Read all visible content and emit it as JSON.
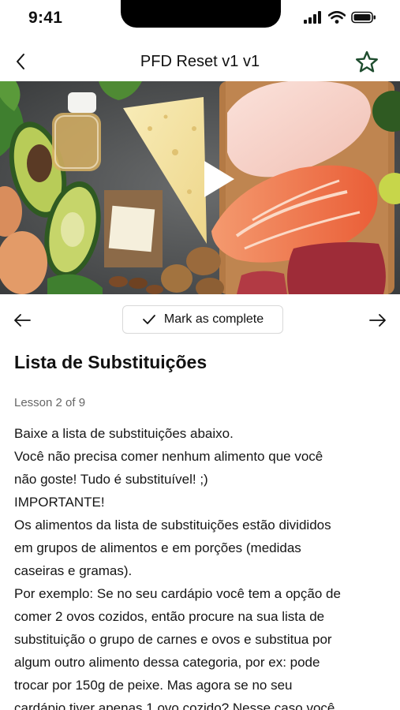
{
  "status_bar": {
    "time": "9:41"
  },
  "header": {
    "title": "PFD Reset v1 v1"
  },
  "hero": {
    "icon": "play-icon",
    "colors": {
      "background": "#4d4f50",
      "salmon": "#f07a4f",
      "cheese": "#f3e3a4"
    }
  },
  "controls": {
    "complete_label": "Mark as complete"
  },
  "lesson": {
    "title": "Lista de Substituições",
    "meta": "Lesson 2 of 9",
    "lines": [
      "Baixe a lista de substituições abaixo.",
      "Você não precisa comer nenhum alimento que você",
      "não goste! Tudo é substituível! ;)",
      "IMPORTANTE!",
      "Os alimentos da lista de substituições estão divididos",
      "em grupos de alimentos e em porções (medidas",
      "caseiras e gramas).",
      "Por exemplo: Se no seu cardápio você tem a opção de",
      "comer 2 ovos cozidos, então procure na sua lista de",
      "substituição o grupo de carnes e ovos e substitua por",
      "algum outro alimento dessa categoria, por ex: pode",
      "trocar por 150g de peixe. Mas agora se no seu",
      "cardápio tiver apenas 1 ovo cozido? Nesse caso você"
    ]
  },
  "theme": {
    "accent": "#1f4d2f",
    "text": "#111111",
    "muted": "#666666",
    "border": "#d9d9d9"
  }
}
